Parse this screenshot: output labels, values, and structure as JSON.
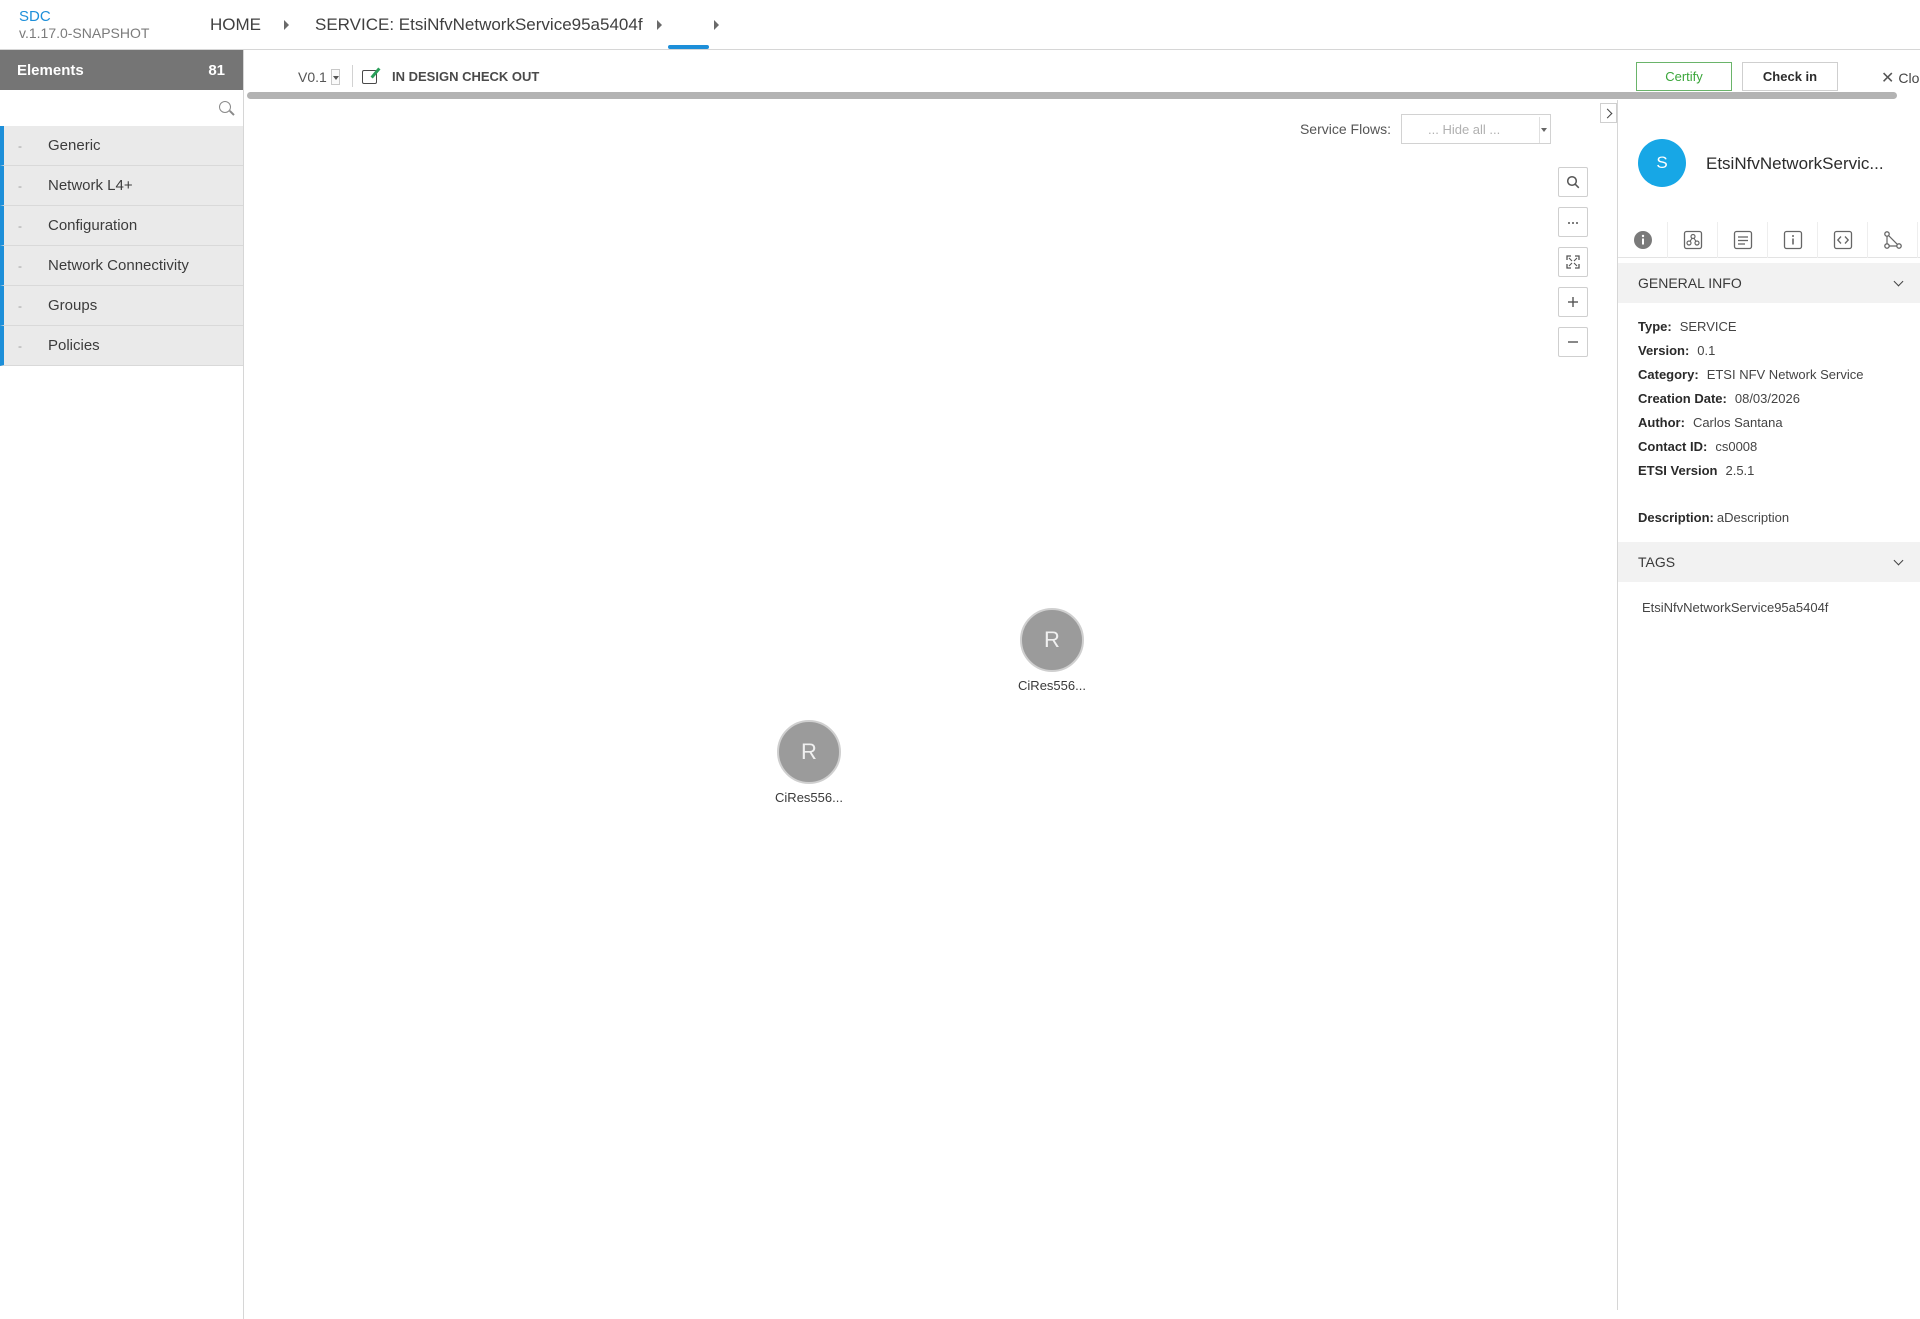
{
  "header": {
    "app_name": "SDC",
    "app_version": "v.1.17.0-SNAPSHOT",
    "breadcrumbs": [
      {
        "label": "HOME"
      },
      {
        "label": "SERVICE: EtsiNfvNetworkService95a5404f"
      },
      {
        "label": ""
      }
    ]
  },
  "palette": {
    "title": "Elements",
    "count": "81",
    "search": {
      "value": "",
      "placeholder": ""
    },
    "items": [
      {
        "label": "Generic"
      },
      {
        "label": "Network L4+"
      },
      {
        "label": "Configuration"
      },
      {
        "label": "Network Connectivity"
      },
      {
        "label": "Groups"
      },
      {
        "label": "Policies"
      }
    ]
  },
  "toolbar": {
    "version": "V0.1",
    "status": "IN DESIGN CHECK OUT",
    "certify_label": "Certify",
    "checkin_label": "Check in",
    "close_label": "Clo"
  },
  "canvas": {
    "service_flows_label": "Service Flows:",
    "service_flows_value": "... Hide all ...",
    "zoom_tools": [
      "search-icon",
      "more-icon",
      "fit-screen-icon",
      "zoom-in-icon",
      "zoom-out-icon"
    ],
    "nodes": [
      {
        "letter": "R",
        "label": "CiRes556..."
      },
      {
        "letter": "R",
        "label": "CiRes556..."
      }
    ]
  },
  "details": {
    "avatar_letter": "S",
    "title": "EtsiNfvNetworkServic...",
    "tabs": [
      "info-icon",
      "composition-icon",
      "list-icon",
      "properties-icon",
      "code-icon",
      "flow-icon"
    ],
    "general_info": {
      "heading": "GENERAL INFO",
      "rows": [
        {
          "label": "Type:",
          "value": "SERVICE"
        },
        {
          "label": "Version:",
          "value": "0.1"
        },
        {
          "label": "Category:",
          "value": "ETSI NFV Network Service"
        },
        {
          "label": "Creation Date:",
          "value": "08/03/2026"
        },
        {
          "label": "Author:",
          "value": "Carlos Santana"
        },
        {
          "label": "Contact ID:",
          "value": "cs0008"
        },
        {
          "label": "ETSI Version",
          "value": "2.5.1"
        }
      ],
      "description_label": "Description:",
      "description_value": "aDescription"
    },
    "tags": {
      "heading": "TAGS",
      "values": [
        "EtsiNfvNetworkService95a5404f"
      ]
    }
  },
  "colors": {
    "accent": "#1d8fd9",
    "palette_header": "#757575",
    "avatar": "#17a7e6",
    "node": "#9b9b9b",
    "certify": "#3aa63a"
  }
}
